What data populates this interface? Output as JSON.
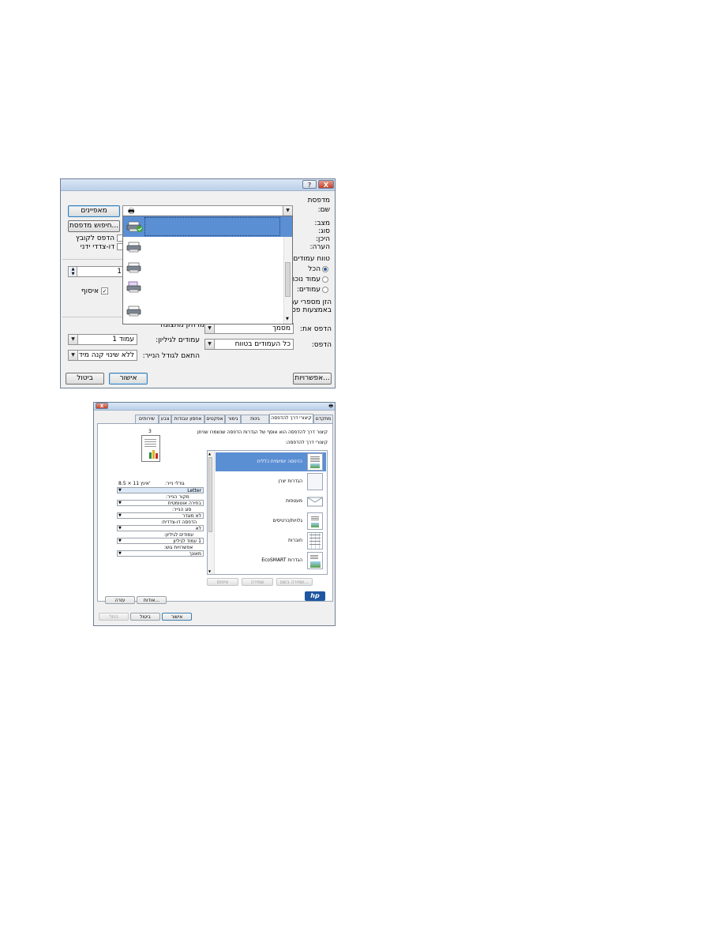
{
  "dialog1": {
    "help_btn": "?",
    "close_btn": "X",
    "printer_group": "מדפסת",
    "name_label": "שם:",
    "status_label": "מצב:",
    "type_label": "סוג:",
    "where_label": "היכן:",
    "comment_label": "הערה:",
    "properties_btn": "מאפיינים",
    "find_printer_btn": "חיפוש מדפסת...",
    "print_to_file": "הדפס לקובץ",
    "manual_duplex": "דו-צדדי ידני",
    "page_range_group": "טווח עמודים",
    "all_pages": "הכל",
    "current_page": "עמוד נוכחי",
    "pages_label": "עמודים:",
    "range_hint_1": "הזן מספרי עמ",
    "range_hint_2": "באמצעות פס",
    "copies_value": "1",
    "collate": "איסוף",
    "zoom_label": "מרחק מתצוגה",
    "pages_per_sheet": "עמודים לגיליון:",
    "pages_per_sheet_value": "עמוד 1",
    "scale_to_paper": "התאם לגודל הנייר:",
    "scale_value": "ללא שינוי קנה מידה",
    "print_what_label": "הדפס את:",
    "print_what_value": "מסמך",
    "print_label": "הדפס:",
    "print_value": "כל העמודים בטווח",
    "options_btn": "אפשרויות...",
    "ok_btn": "אישור",
    "cancel_btn": "ביטול"
  },
  "dialog2": {
    "close_btn": "X",
    "tabs": [
      "שירותים",
      "צבע",
      "אחסון עבודות",
      "אפקטים",
      "גימור",
      "גינות",
      "מתקדם"
    ],
    "active_tab": "קיצורי דרך להדפסה",
    "description": "קיצור דרך להדפסה הוא אוסף של הגדרות הדפסה שנשמרו שניתן",
    "shortcuts_label": "קיצורי דרך להדפסה:",
    "paper_size_label": "גודלי נייר:",
    "paper_size_dim": "8.5 × 11 אינץ'",
    "paper_size_value": "Letter",
    "paper_source_label": "מקור הנייר:",
    "paper_source_value": "בחירה אוטומטית",
    "paper_type_label": "סוג הנייר:",
    "paper_type_value": "לא מוגדר",
    "duplex_label": "הדפסה דו-צדדית:",
    "duplex_value": "לא",
    "pps_label": "עמודים לגיליון:",
    "pps_value": "1 עמוד לגיליון",
    "rotate_label": "אפשרויות גוש:",
    "rotate_value": "מאונך",
    "shortcuts": [
      "הדפסה יומיומית כללית",
      "הגדרות יצרן",
      "מעטפות",
      "גלויות/כרטיסים",
      "חוברות",
      "הגדרות EcoSMART"
    ],
    "save_as_btn": "שמירה בשם...",
    "save_btn": "שמירה",
    "delete_btn": "איפוס",
    "about_btn": "אודות...",
    "help_btn": "עזרה",
    "ok_btn": "אישור",
    "cancel_btn": "ביטול",
    "apply_btn": "החל",
    "logo": "hp"
  },
  "colors": {
    "selection": "#5b8fd4",
    "title_grad": "#bcd0ea",
    "close": "#c8412a"
  }
}
